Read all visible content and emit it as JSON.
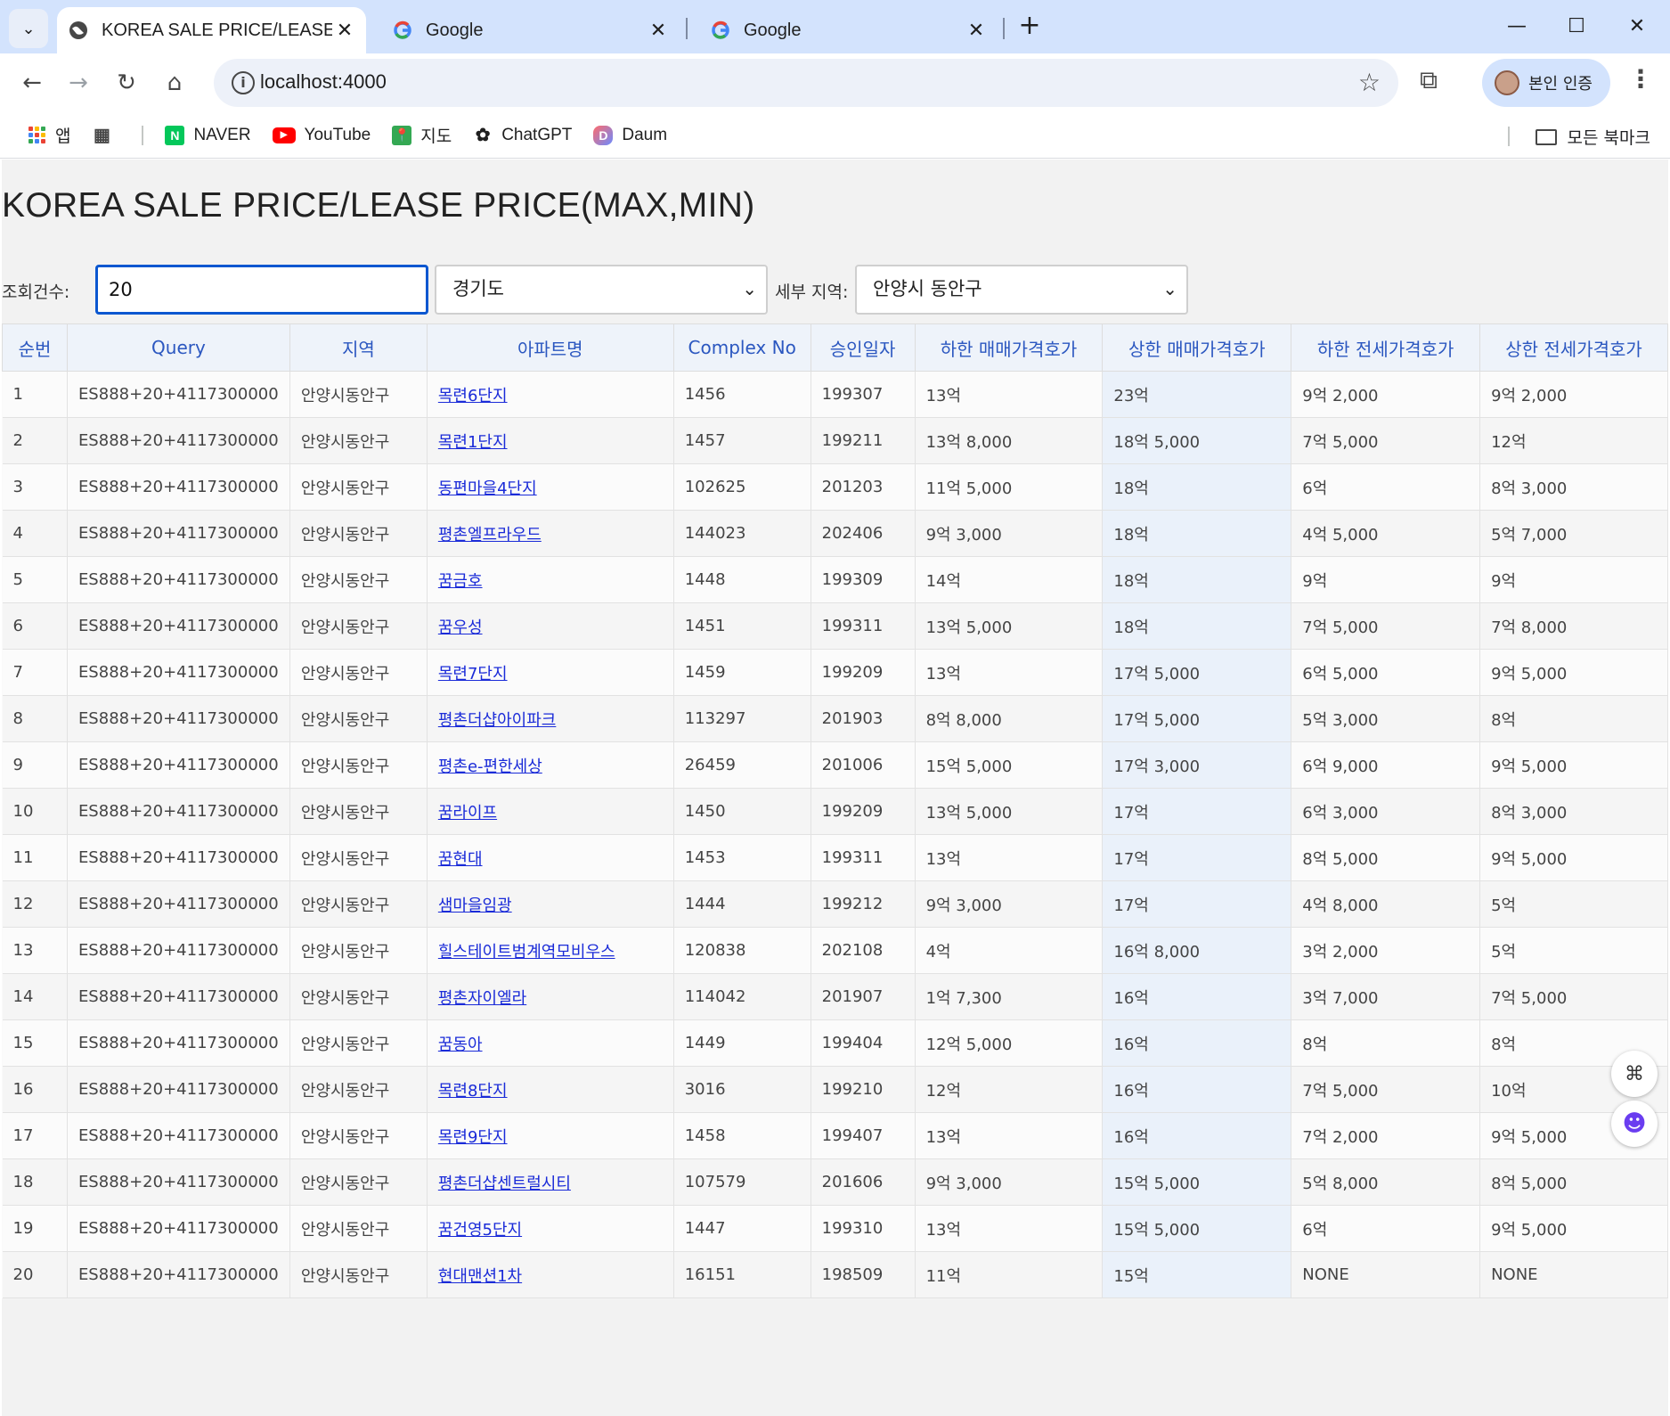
{
  "tabs": [
    {
      "title": "KOREA SALE PRICE/LEASE PRICE",
      "icon": "globe-icon"
    },
    {
      "title": "Google",
      "icon": "google-icon"
    },
    {
      "title": "Google",
      "icon": "google-icon"
    }
  ],
  "address_bar": {
    "url": "localhost:4000"
  },
  "profile": {
    "label": "본인 인증"
  },
  "bookmarks": [
    {
      "label": "앱"
    },
    {
      "label": ""
    },
    {
      "label": "NAVER"
    },
    {
      "label": "YouTube"
    },
    {
      "label": "지도"
    },
    {
      "label": "ChatGPT"
    },
    {
      "label": "Daum"
    }
  ],
  "all_bookmarks": "모든 북마크",
  "page": {
    "title": "KOREA SALE PRICE/LEASE PRICE(MAX,MIN)",
    "count_label": "조회건수:",
    "count_value": "20",
    "province": "경기도",
    "sub_region_label": "세부 지역:",
    "sub_region": "안양시 동안구"
  },
  "table": {
    "headers": [
      "순번",
      "Query",
      "지역",
      "아파트명",
      "Complex No",
      "승인일자",
      "하한 매매가격호가",
      "상한 매매가격호가",
      "하한 전세가격호가",
      "상한 전세가격호가"
    ],
    "rows": [
      [
        "1",
        "ES888+20+4117300000",
        "안양시동안구",
        "목련6단지",
        "1456",
        "199307",
        "13억",
        "23억",
        "9억 2,000",
        "9억 2,000"
      ],
      [
        "2",
        "ES888+20+4117300000",
        "안양시동안구",
        "목련1단지",
        "1457",
        "199211",
        "13억 8,000",
        "18억 5,000",
        "7억 5,000",
        "12억"
      ],
      [
        "3",
        "ES888+20+4117300000",
        "안양시동안구",
        "동편마을4단지",
        "102625",
        "201203",
        "11억 5,000",
        "18억",
        "6억",
        "8억 3,000"
      ],
      [
        "4",
        "ES888+20+4117300000",
        "안양시동안구",
        "평촌엘프라우드",
        "144023",
        "202406",
        "9억 3,000",
        "18억",
        "4억 5,000",
        "5억 7,000"
      ],
      [
        "5",
        "ES888+20+4117300000",
        "안양시동안구",
        "꿈금호",
        "1448",
        "199309",
        "14억",
        "18억",
        "9억",
        "9억"
      ],
      [
        "6",
        "ES888+20+4117300000",
        "안양시동안구",
        "꿈우성",
        "1451",
        "199311",
        "13억 5,000",
        "18억",
        "7억 5,000",
        "7억 8,000"
      ],
      [
        "7",
        "ES888+20+4117300000",
        "안양시동안구",
        "목련7단지",
        "1459",
        "199209",
        "13억",
        "17억 5,000",
        "6억 5,000",
        "9억 5,000"
      ],
      [
        "8",
        "ES888+20+4117300000",
        "안양시동안구",
        "평촌더샵아이파크",
        "113297",
        "201903",
        "8억 8,000",
        "17억 5,000",
        "5억 3,000",
        "8억"
      ],
      [
        "9",
        "ES888+20+4117300000",
        "안양시동안구",
        "평촌e-편한세상",
        "26459",
        "201006",
        "15억 5,000",
        "17억 3,000",
        "6억 9,000",
        "9억 5,000"
      ],
      [
        "10",
        "ES888+20+4117300000",
        "안양시동안구",
        "꿈라이프",
        "1450",
        "199209",
        "13억 5,000",
        "17억",
        "6억 3,000",
        "8억 3,000"
      ],
      [
        "11",
        "ES888+20+4117300000",
        "안양시동안구",
        "꿈현대",
        "1453",
        "199311",
        "13억",
        "17억",
        "8억 5,000",
        "9억 5,000"
      ],
      [
        "12",
        "ES888+20+4117300000",
        "안양시동안구",
        "샘마을임광",
        "1444",
        "199212",
        "9억 3,000",
        "17억",
        "4억 8,000",
        "5억"
      ],
      [
        "13",
        "ES888+20+4117300000",
        "안양시동안구",
        "힐스테이트범계역모비우스",
        "120838",
        "202108",
        "4억",
        "16억 8,000",
        "3억 2,000",
        "5억"
      ],
      [
        "14",
        "ES888+20+4117300000",
        "안양시동안구",
        "평촌자이엘라",
        "114042",
        "201907",
        "1억 7,300",
        "16억",
        "3억 7,000",
        "7억 5,000"
      ],
      [
        "15",
        "ES888+20+4117300000",
        "안양시동안구",
        "꿈동아",
        "1449",
        "199404",
        "12억 5,000",
        "16억",
        "8억",
        "8억"
      ],
      [
        "16",
        "ES888+20+4117300000",
        "안양시동안구",
        "목련8단지",
        "3016",
        "199210",
        "12억",
        "16억",
        "7억 5,000",
        "10억"
      ],
      [
        "17",
        "ES888+20+4117300000",
        "안양시동안구",
        "목련9단지",
        "1458",
        "199407",
        "13억",
        "16억",
        "7억 2,000",
        "9억 5,000"
      ],
      [
        "18",
        "ES888+20+4117300000",
        "안양시동안구",
        "평촌더샵센트럴시티",
        "107579",
        "201606",
        "9억 3,000",
        "15억 5,000",
        "5억 8,000",
        "8억 5,000"
      ],
      [
        "19",
        "ES888+20+4117300000",
        "안양시동안구",
        "꿈건영5단지",
        "1447",
        "199310",
        "13억",
        "15억 5,000",
        "6억",
        "9억 5,000"
      ],
      [
        "20",
        "ES888+20+4117300000",
        "안양시동안구",
        "현대맨션1차",
        "16151",
        "198509",
        "11억",
        "15억",
        "NONE",
        "NONE"
      ]
    ]
  },
  "colors": {
    "accent": "#0b57d0",
    "header_text": "#2b57c0",
    "link": "#1a2bd8",
    "tabbar": "#d3e3fd"
  }
}
